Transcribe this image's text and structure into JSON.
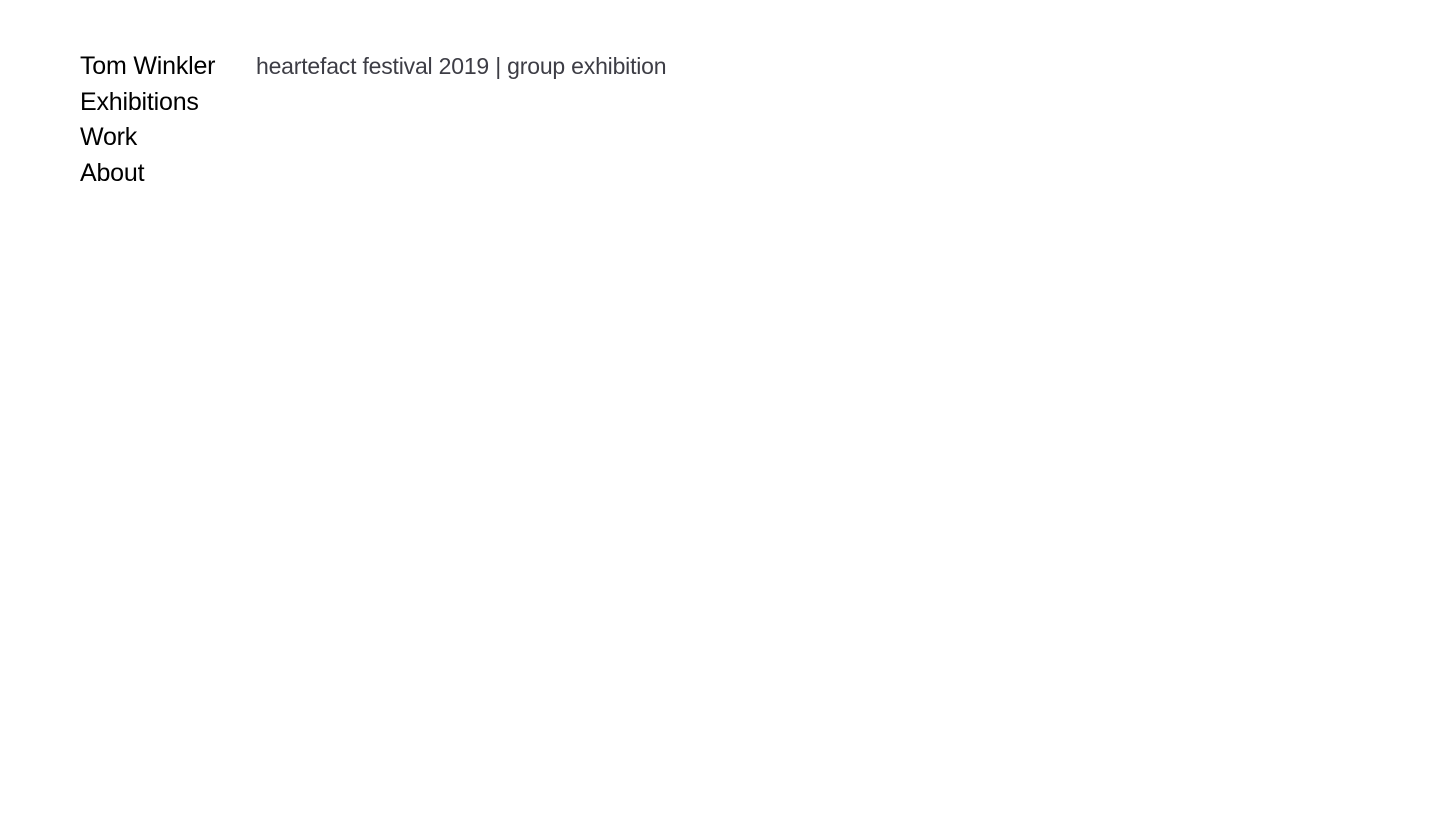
{
  "nav": {
    "site_title": "Tom Winkler",
    "items": [
      {
        "label": "Exhibitions"
      },
      {
        "label": "Work"
      },
      {
        "label": "About"
      }
    ]
  },
  "main": {
    "heading": "heartefact festival 2019 | group exhibition"
  },
  "colors": {
    "background": "#ffffff",
    "nav_text": "#000000",
    "heading_text": "#3d3d45"
  }
}
